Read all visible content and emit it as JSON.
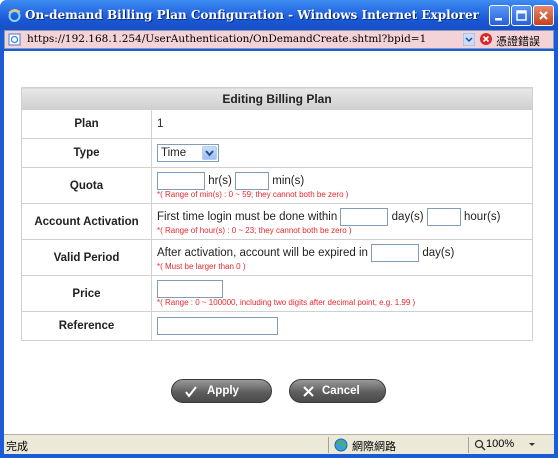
{
  "window": {
    "title": "On-demand Billing Plan Configuration - Windows Internet Explorer"
  },
  "address": {
    "url": "https://192.168.1.254/UserAuthentication/OnDemandCreate.shtml?bpid=1",
    "cert_error": "憑證錯誤"
  },
  "form": {
    "heading": "Editing Billing Plan",
    "plan": {
      "label": "Plan",
      "value": "1"
    },
    "type": {
      "label": "Type",
      "selected": "Time"
    },
    "quota": {
      "label": "Quota",
      "hours_value": "",
      "hours_unit": "hr(s)",
      "mins_value": "",
      "mins_unit": "min(s)",
      "hint": "*( Range of min(s) : 0 ~ 59; they cannot both be zero )"
    },
    "activation": {
      "label": "Account Activation",
      "prefix": "First time login must be done within",
      "days_value": "",
      "days_unit": "day(s)",
      "hours_value": "",
      "hours_unit": "hour(s)",
      "hint": "*( Range of hour(s) : 0 ~ 23; they cannot both be zero )"
    },
    "valid": {
      "label": "Valid Period",
      "prefix": "After activation, account will be expired in",
      "days_value": "",
      "days_unit": "day(s)",
      "hint": "*( Must be larger than 0 )"
    },
    "price": {
      "label": "Price",
      "value": "",
      "hint": "*( Range : 0 ~ 100000, including two digits after decimal point, e.g. 1.99 )"
    },
    "reference": {
      "label": "Reference",
      "value": ""
    }
  },
  "buttons": {
    "apply": "Apply",
    "cancel": "Cancel"
  },
  "status": {
    "text": "完成",
    "zone": "網際網路",
    "zoom": "100%"
  },
  "colors": {
    "title_bar": "#2a6fe6",
    "address_bar_error": "#f3d2d8",
    "hint_red": "#e8262e",
    "header_gray": "#d8d8d8",
    "button_gray": "#5e5e5e"
  }
}
